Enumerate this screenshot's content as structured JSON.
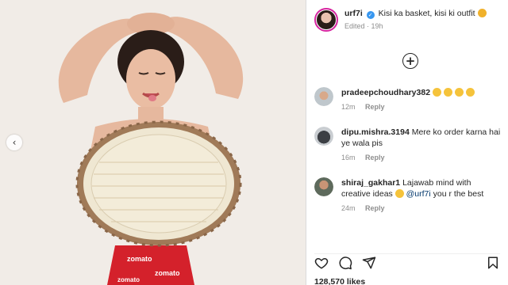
{
  "post": {
    "username": "urf7i",
    "caption": "Kisi ka basket, kisi ki outfit",
    "edited_label": "Edited",
    "age": "19h",
    "likes": "128,570 likes"
  },
  "comments": [
    {
      "username": "pradeepchoudhary382",
      "text": "",
      "emoji_count": 4,
      "time": "12m",
      "reply_label": "Reply"
    },
    {
      "username": "dipu.mishra.3194",
      "text": "Mere ko order karna hai ye wala pis",
      "time": "16m",
      "reply_label": "Reply"
    },
    {
      "username": "shiraj_gakhar1",
      "text": "Lajawab mind with creative ideas",
      "mention": "@urf7i",
      "text_after": "you r the best",
      "time": "24m",
      "reply_label": "Reply"
    }
  ],
  "icons": {
    "verified": "verified-badge-icon",
    "add_comment": "plus-circle-icon",
    "like": "heart-icon",
    "comment": "comment-bubble-icon",
    "share": "send-icon",
    "save": "bookmark-icon",
    "prev": "chevron-left-icon"
  },
  "colors": {
    "verified": "#3897f0",
    "ring": "#d6249f",
    "background": "#f1ece7"
  }
}
